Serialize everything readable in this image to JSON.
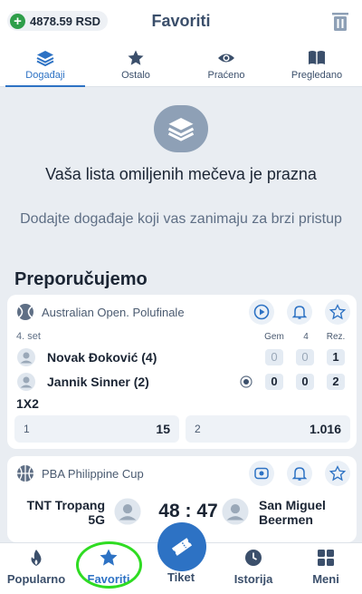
{
  "header": {
    "balance": "4878.59 RSD",
    "title": "Favoriti",
    "balance_icon": "plus-icon",
    "action_icon": "trash-icon"
  },
  "tabs": [
    {
      "label": "Događaji",
      "icon": "stack-icon",
      "active": true
    },
    {
      "label": "Ostalo",
      "icon": "star-icon",
      "active": false
    },
    {
      "label": "Praćeno",
      "icon": "eye-icon",
      "active": false
    },
    {
      "label": "Pregledano",
      "icon": "book-icon",
      "active": false
    }
  ],
  "empty_state": {
    "icon": "stack-icon",
    "title": "Vaša lista omiljenih mečeva je prazna",
    "subtitle": "Dodajte događaje koji vas zanimaju za brzi pristup"
  },
  "recommended": {
    "title": "Preporučujemo",
    "match1": {
      "sport_icon": "tennis-ball-icon",
      "league": "Australian Open. Polufinale",
      "set": "4. set",
      "col_gem": "Gem",
      "col_set": "4",
      "col_rez": "Rez.",
      "player1": {
        "name": "Novak Đoković (4)",
        "gem": "0",
        "set": "0",
        "rez": "1"
      },
      "player2": {
        "name": "Jannik Sinner (2)",
        "gem": "0",
        "set": "0",
        "rez": "2",
        "serving_icon": "serve-indicator-icon"
      },
      "market": "1X2",
      "odds": [
        {
          "label": "1",
          "value": "15"
        },
        {
          "label": "2",
          "value": "1.016"
        }
      ]
    },
    "match2": {
      "sport_icon": "basketball-icon",
      "league": "PBA Philippine Cup",
      "team_home_line1": "TNT Tropang",
      "team_home_line2": "5G",
      "score": "48 : 47",
      "team_away_line1": "San Miguel",
      "team_away_line2": "Beermen"
    }
  },
  "bottom_nav": [
    {
      "label": "Popularno",
      "icon": "flame-icon",
      "active": false
    },
    {
      "label": "Favoriti",
      "icon": "star-icon",
      "active": true
    },
    {
      "label": "Tiket",
      "icon": "ticket-icon",
      "active": false
    },
    {
      "label": "Istorija",
      "icon": "clock-icon",
      "active": false
    },
    {
      "label": "Meni",
      "icon": "grid-icon",
      "active": false
    }
  ],
  "colors": {
    "accent": "#2d72c4",
    "positive": "#2e9e4a",
    "highlight_ring": "#2fdc22",
    "background": "#e9edf2"
  }
}
